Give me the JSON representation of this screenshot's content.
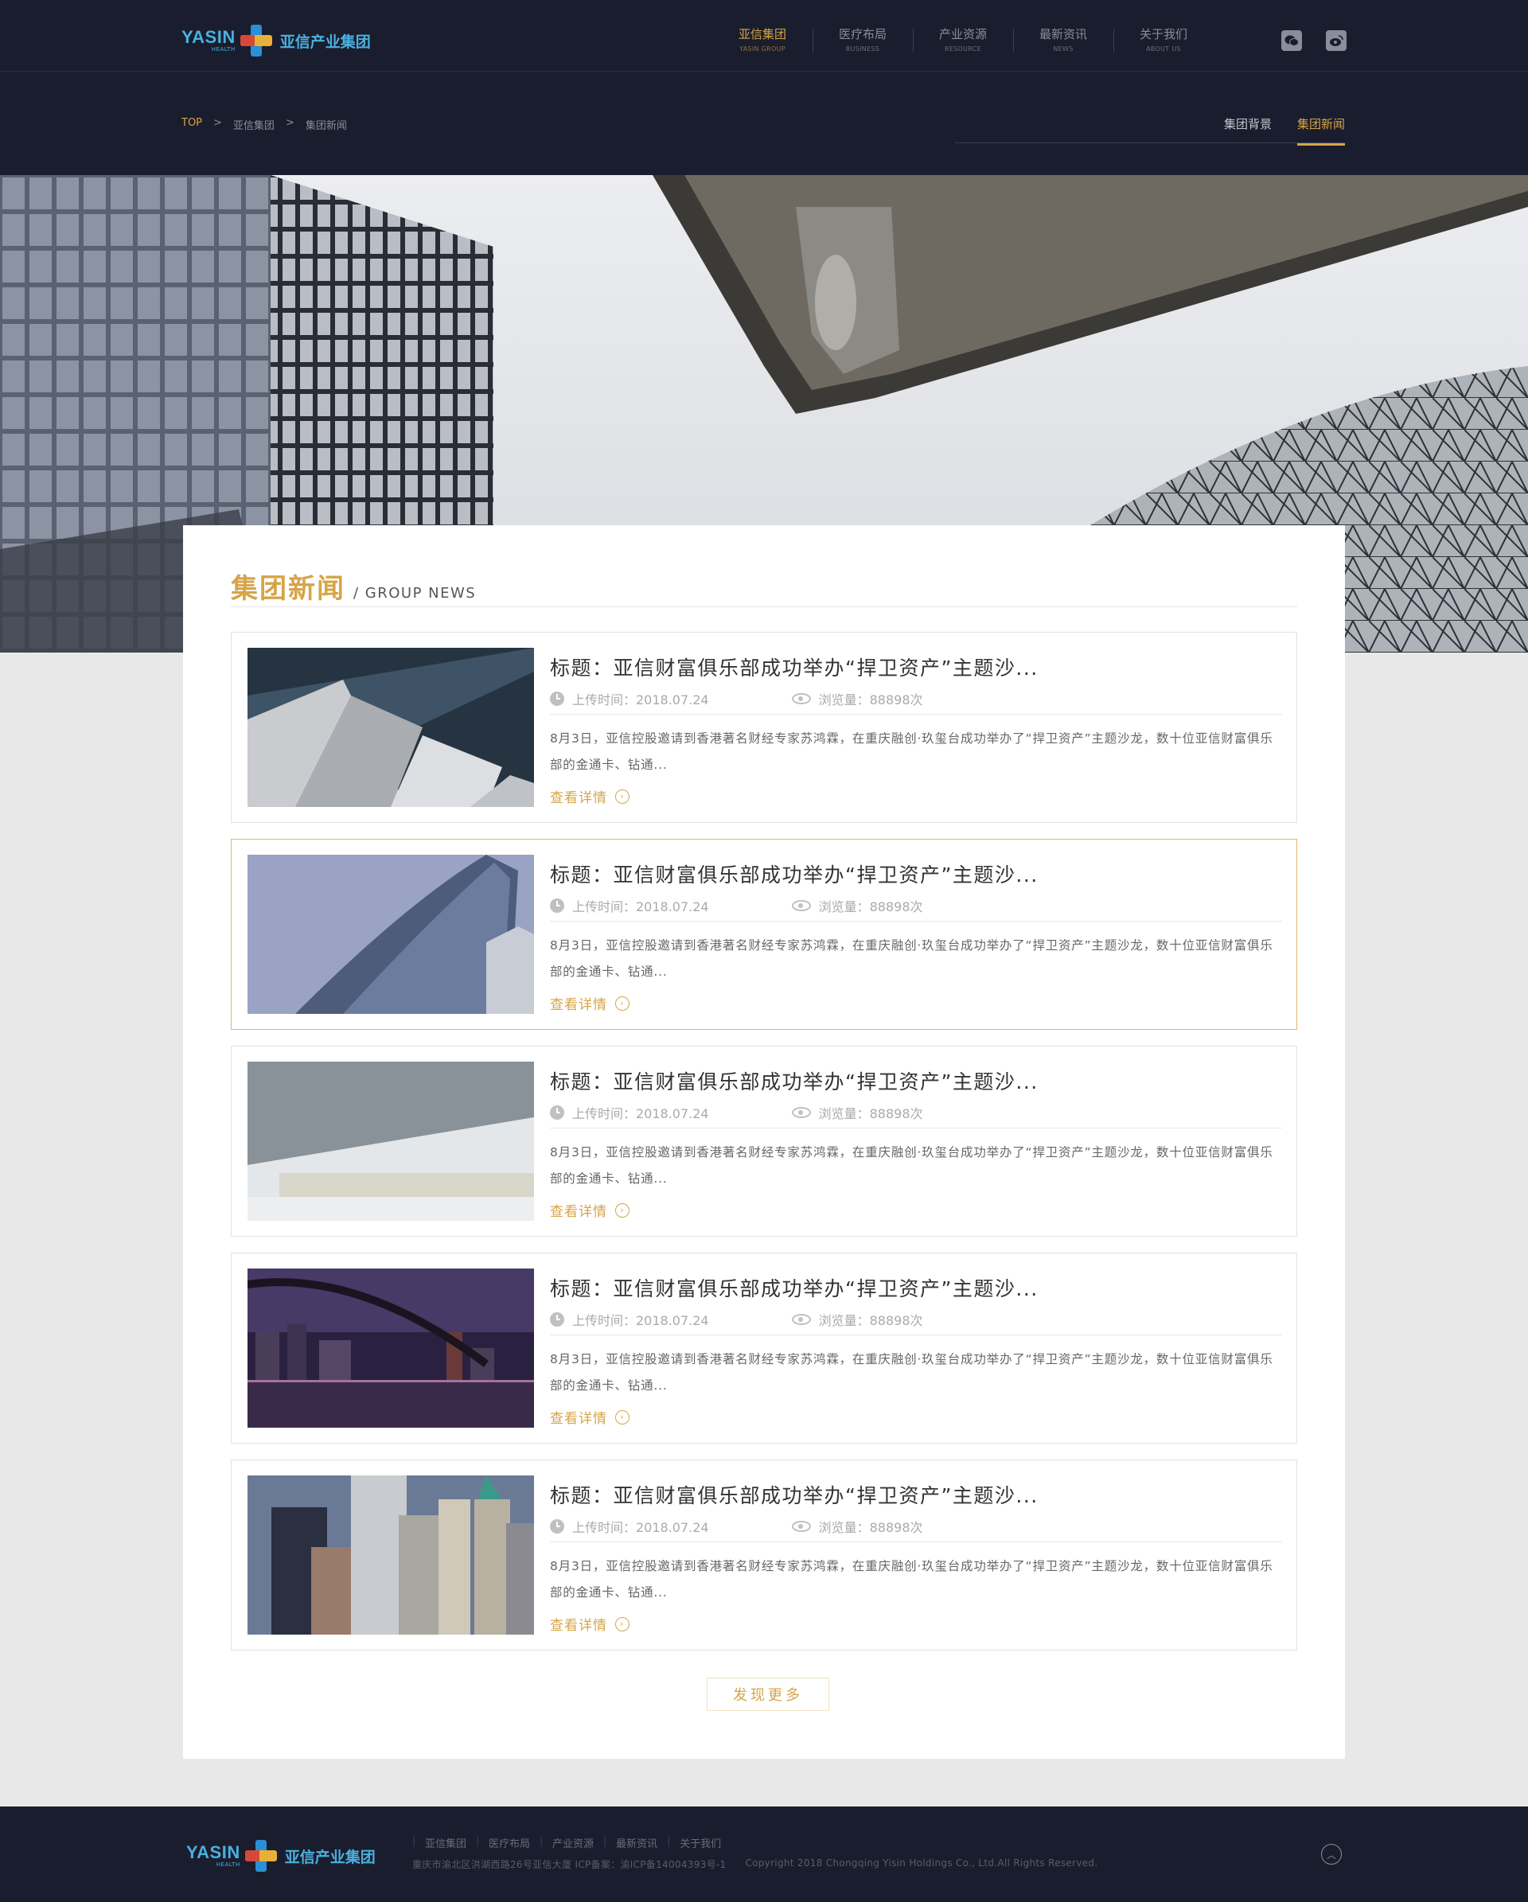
{
  "brand": {
    "en": "YASIN",
    "en_sub": "HEALTH",
    "cn": "亚信产业集团"
  },
  "nav": [
    {
      "cn": "亚信集团",
      "en": "YASIN GROUP",
      "active": true
    },
    {
      "cn": "医疗布局",
      "en": "BUSINESS"
    },
    {
      "cn": "产业资源",
      "en": "RESOURCE"
    },
    {
      "cn": "最新资讯",
      "en": "NEWS"
    },
    {
      "cn": "关于我们",
      "en": "ABOUT US"
    }
  ],
  "social": {
    "wechat_icon": "wechat-icon",
    "weibo_icon": "weibo-icon"
  },
  "breadcrumb": {
    "top": "TOP",
    "sep": ">",
    "level1": "亚信集团",
    "level2": "集团新闻"
  },
  "subnav": {
    "background": "集团背景",
    "news": "集团新闻"
  },
  "section": {
    "title_cn": "集团新闻",
    "title_en": "/ GROUP NEWS"
  },
  "news": [
    {
      "title": "标题：亚信财富俱乐部成功举办“捍卫资产”主题沙...",
      "date_label": "上传时间：2018.07.24",
      "views_label": "浏览量：88898次",
      "excerpt": "8月3日，亚信控股邀请到香港著名财经专家苏鸿霖，在重庆融创·玖玺台成功举办了“捍卫资产”主题沙龙，数十位亚信财富俱乐部的金通卡、钻通...",
      "more": "查看详情"
    },
    {
      "title": "标题：亚信财富俱乐部成功举办“捍卫资产”主题沙...",
      "date_label": "上传时间：2018.07.24",
      "views_label": "浏览量：88898次",
      "excerpt": "8月3日，亚信控股邀请到香港著名财经专家苏鸿霖，在重庆融创·玖玺台成功举办了“捍卫资产”主题沙龙，数十位亚信财富俱乐部的金通卡、钻通...",
      "more": "查看详情"
    },
    {
      "title": "标题：亚信财富俱乐部成功举办“捍卫资产”主题沙...",
      "date_label": "上传时间：2018.07.24",
      "views_label": "浏览量：88898次",
      "excerpt": "8月3日，亚信控股邀请到香港著名财经专家苏鸿霖，在重庆融创·玖玺台成功举办了“捍卫资产”主题沙龙，数十位亚信财富俱乐部的金通卡、钻通...",
      "more": "查看详情"
    },
    {
      "title": "标题：亚信财富俱乐部成功举办“捍卫资产”主题沙...",
      "date_label": "上传时间：2018.07.24",
      "views_label": "浏览量：88898次",
      "excerpt": "8月3日，亚信控股邀请到香港著名财经专家苏鸿霖，在重庆融创·玖玺台成功举办了“捍卫资产”主题沙龙，数十位亚信财富俱乐部的金通卡、钻通...",
      "more": "查看详情"
    },
    {
      "title": "标题：亚信财富俱乐部成功举办“捍卫资产”主题沙...",
      "date_label": "上传时间：2018.07.24",
      "views_label": "浏览量：88898次",
      "excerpt": "8月3日，亚信控股邀请到香港著名财经专家苏鸿霖，在重庆融创·玖玺台成功举办了“捍卫资产”主题沙龙，数十位亚信财富俱乐部的金通卡、钻通...",
      "more": "查看详情"
    }
  ],
  "load_more": "发现更多",
  "footer": {
    "nav": [
      "亚信集团",
      "医疗布局",
      "产业资源",
      "最新资讯",
      "关于我们"
    ],
    "address": "重庆市渝北区洪湖西路26号亚信大厦 ICP备案：渝ICP备14004393号-1",
    "copyright": "Copyright  2018 Chongqing Yisin Holdings Co., Ltd.All Rights Reserved."
  },
  "colors": {
    "accent": "#d6a447",
    "header_bg": "#1a1d2d",
    "brand_blue": "#4ab0e0"
  }
}
